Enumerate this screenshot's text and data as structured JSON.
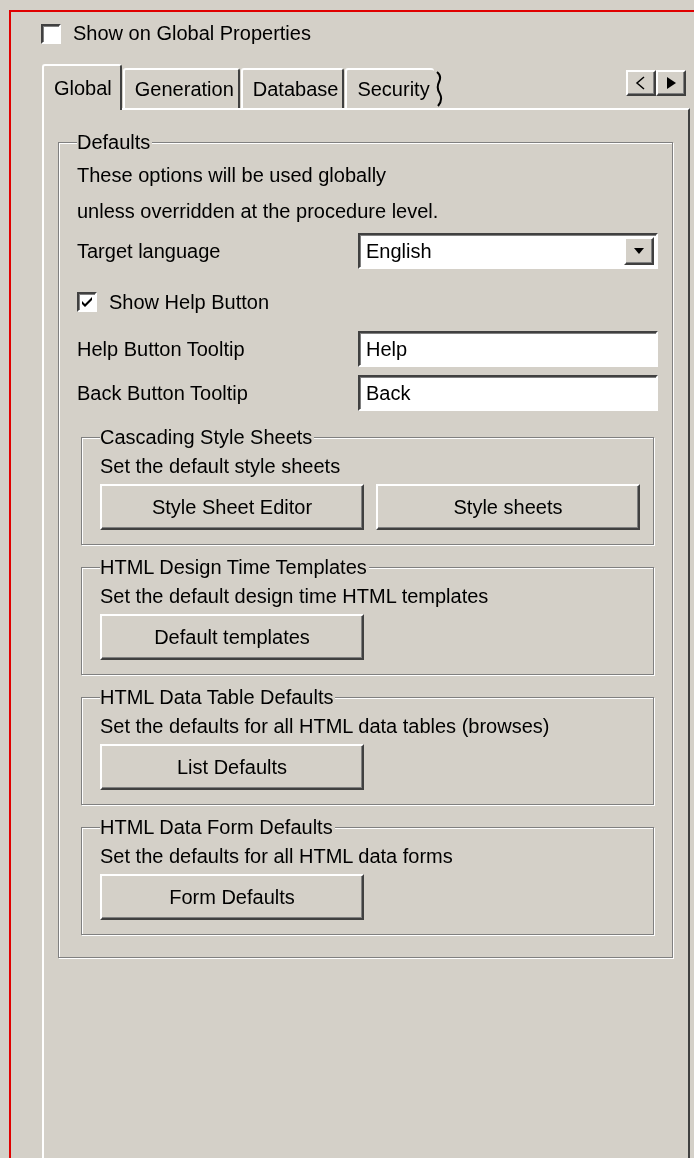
{
  "show_on_global": {
    "label": "Show on Global Properties",
    "checked": false
  },
  "tabs": [
    {
      "label": "Global",
      "selected": true
    },
    {
      "label": "Generation",
      "selected": false
    },
    {
      "label": "Database",
      "selected": false
    },
    {
      "label": "Security",
      "selected": false
    }
  ],
  "defaults": {
    "title": "Defaults",
    "description": [
      "These options will be used globally",
      "unless overridden at the procedure level."
    ],
    "target_language": {
      "label": "Target language",
      "value": "English"
    },
    "show_help_button": {
      "label": "Show Help Button",
      "checked": true
    },
    "fields": [
      {
        "label": "Help Button Tooltip",
        "value": "Help"
      },
      {
        "label": "Back Button Tooltip",
        "value": "Back"
      }
    ],
    "groups": [
      {
        "title": "Cascading Style Sheets",
        "description": "Set the default style sheets",
        "buttons": [
          "Style Sheet Editor",
          "Style sheets"
        ]
      },
      {
        "title": "HTML Design Time Templates",
        "description": "Set the default design time HTML templates",
        "buttons": [
          "Default templates"
        ]
      },
      {
        "title": "HTML Data Table Defaults",
        "description": "Set the defaults for all HTML data tables (browses)",
        "buttons": [
          "List Defaults"
        ]
      },
      {
        "title": "HTML Data Form Defaults",
        "description": "Set the defaults for all HTML data forms",
        "buttons": [
          "Form Defaults"
        ]
      }
    ]
  }
}
